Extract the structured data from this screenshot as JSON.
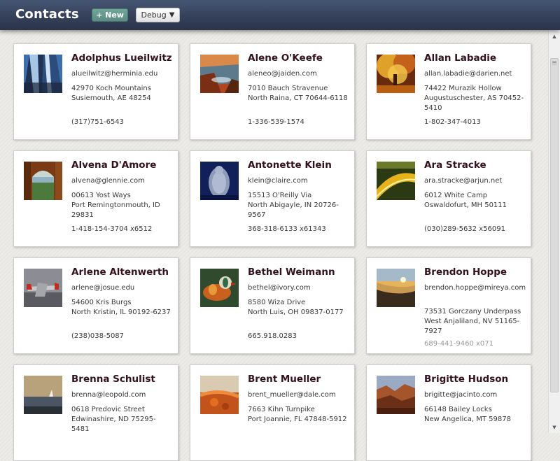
{
  "header": {
    "title": "Contacts",
    "new_button": "+ New",
    "debug_button": "Debug",
    "debug_caret": "▼"
  },
  "contacts": [
    {
      "name": "Adolphus Lueilwitz",
      "email": "alueilwitz@herminia.edu",
      "address": "42970 Koch Mountains\nSusiemouth, AE  48254",
      "phone": "(317)751-6543",
      "thumb": "skyscraper-photo"
    },
    {
      "name": "Alene O'Keefe",
      "email": "aleneo@jaiden.com",
      "address": "7010 Bauch Stravenue\nNorth Raina, CT  70644-6118",
      "phone": "1-336-539-1574",
      "thumb": "coastal-rocks-photo"
    },
    {
      "name": "Allan Labadie",
      "email": "allan.labadie@darien.net",
      "address": "74422 Murazik Hollow\nAugustuschester, AS  70452-5410",
      "phone": "1-802-347-4013",
      "thumb": "autumn-tree-photo"
    },
    {
      "name": "Alvena D'Amore",
      "email": "alvena@glennie.com",
      "address": "00613 Yost Ways\nPort Remingtonmouth, ID  29831",
      "phone": "1-418-154-3704 x6512",
      "thumb": "stone-archway-photo"
    },
    {
      "name": "Antonette Klein",
      "email": "klein@claire.com",
      "address": "15513 O'Reilly Via\nNorth Abigayle, IN  20726-9567",
      "phone": "368-318-6133 x61343",
      "thumb": "wire-sculpture-photo"
    },
    {
      "name": "Ara Stracke",
      "email": "ara.stracke@arjun.net",
      "address": "6012 White Camp\nOswaldofurt, MH  50111",
      "phone": "(030)289-5632 x56091",
      "thumb": "road-lights-photo"
    },
    {
      "name": "Arlene Altenwerth",
      "email": "arlene@josue.edu",
      "address": "54600 Kris Burgs\nNorth Kristin, IL  90192-6237",
      "phone": "(238)038-5087",
      "thumb": "airplane-photo"
    },
    {
      "name": "Bethel Weimann",
      "email": "bethel@ivory.com",
      "address": "8580 Wiza Drive\nNorth Luis, OH  09837-0177",
      "phone": "665.918.0283",
      "thumb": "mandarin-duck-photo"
    },
    {
      "name": "Brendon Hoppe",
      "email": "brendon.hoppe@mireya.com",
      "address": "73531 Gorczany Underpass\nWest Anjaliland, NV  51165-7927",
      "phone": "689-441-9460 x071",
      "thumb": "beach-sunset-photo"
    },
    {
      "name": "Brenna Schulist",
      "email": "brenna@leopold.com",
      "address": "0618 Predovic Street\nEdwinashire, ND  75295-5481",
      "phone": "",
      "thumb": "sea-sunset-photo"
    },
    {
      "name": "Brent Mueller",
      "email": "brent_mueller@dale.com",
      "address": "7663 Kihn Turnpike\nPort Joannie, FL  47848-5912",
      "phone": "",
      "thumb": "orange-grass-photo"
    },
    {
      "name": "Brigitte Hudson",
      "email": "brigitte@jacinto.com",
      "address": "66148 Bailey Locks\nNew Angelica, MT  59878",
      "phone": "",
      "thumb": "canyon-photo"
    }
  ]
}
